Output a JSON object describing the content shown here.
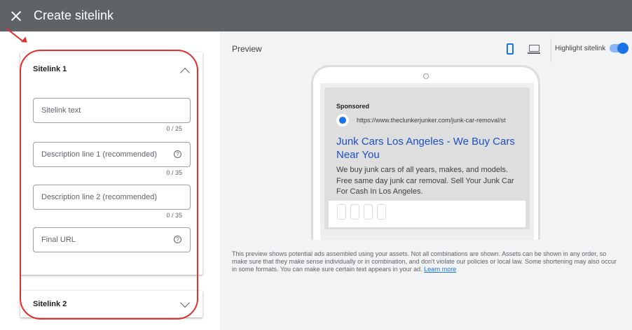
{
  "header": {
    "title": "Create sitelink",
    "close_icon": "close-icon"
  },
  "form": {
    "sitelink1": {
      "title": "Sitelink 1",
      "expanded": true,
      "fields": [
        {
          "placeholder": "Sitelink text",
          "counter": "0 / 25",
          "help": false
        },
        {
          "placeholder": "Description line 1 (recommended)",
          "counter": "0 / 35",
          "help": true
        },
        {
          "placeholder": "Description line 2 (recommended)",
          "counter": "0 / 35",
          "help": false
        },
        {
          "placeholder": "Final URL",
          "counter": "",
          "help": true
        }
      ]
    },
    "sitelink2": {
      "title": "Sitelink 2",
      "expanded": false
    }
  },
  "preview": {
    "label": "Preview",
    "highlight_label": "Highlight sitelink",
    "highlight_on": true,
    "device_selected": "mobile",
    "ad": {
      "sponsored": "Sponsored",
      "url": "https://www.theclunkerjunker.com/junk-car-removal/st",
      "headline": "Junk Cars Los Angeles - We Buy Cars Near You",
      "description": "We buy junk cars of all years, makes, and models. Free same day junk car removal. Sell Your Junk Car For Cash In Los Angeles."
    },
    "disclaimer": "This preview shows potential ads assembled using your assets. Not all combinations are shown. Assets can be shown in any order, so make sure that they make sense individually or in combination, and don't violate our policies or local law. Some shortening may also occur in some formats. You can make sure certain text appears in your ad.",
    "learn_more": "Learn more"
  },
  "colors": {
    "topbar": "#5f6368",
    "accent": "#1a73e8",
    "annotation": "#e03030"
  },
  "help_glyph": "?"
}
